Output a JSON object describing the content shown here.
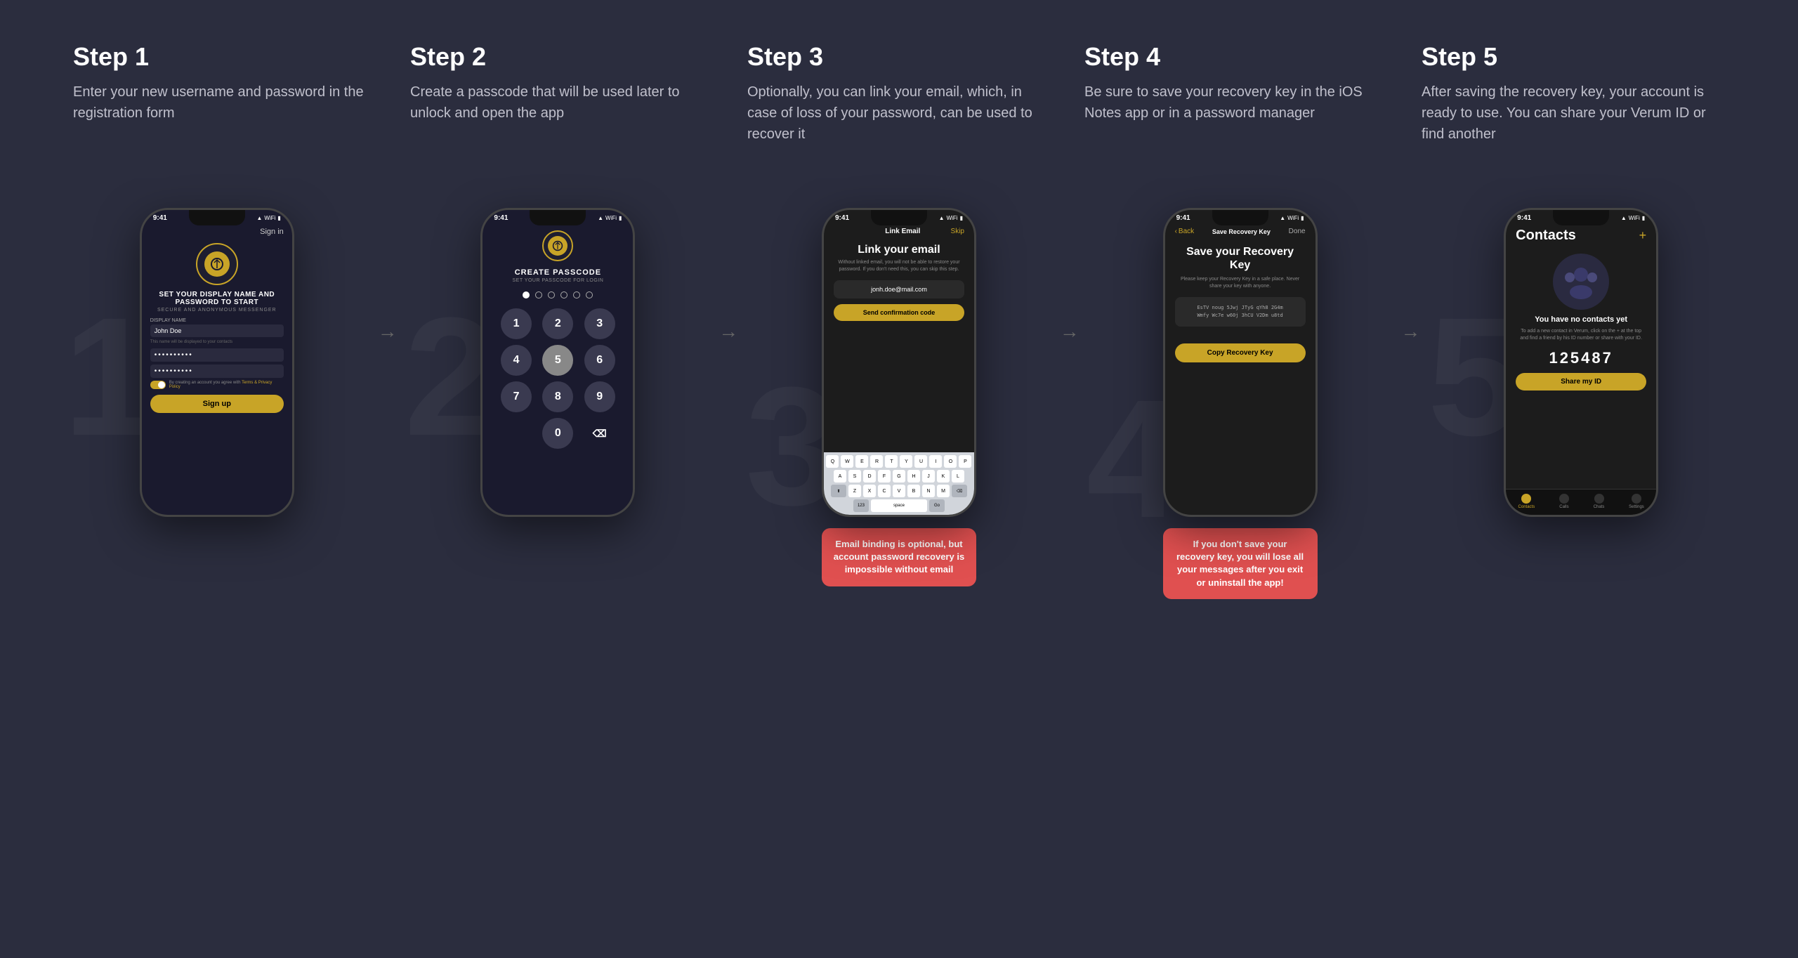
{
  "steps": [
    {
      "number": "Step 1",
      "description": "Enter your new username and password in the registration form",
      "bg_number": "1"
    },
    {
      "number": "Step 2",
      "description": "Create a passcode that will be used later to unlock and open the app",
      "bg_number": "2"
    },
    {
      "number": "Step 3",
      "description": "Optionally, you can link your email, which, in case of loss of your password, can be used to recover it",
      "bg_number": "3"
    },
    {
      "number": "Step 4",
      "description": "Be sure to save your recovery key in the iOS Notes app or in a password manager",
      "bg_number": "4"
    },
    {
      "number": "Step 5",
      "description": "After saving the recovery key, your account is ready to use. You can share your Verum ID or find another",
      "bg_number": "5"
    }
  ],
  "phone1": {
    "time": "9:41",
    "sign_in": "Sign in",
    "title": "SET YOUR DISPLAY NAME AND PASSWORD TO START",
    "subtitle": "SECURE AND ANONYMOUS MESSENGER",
    "display_name_label": "DISPLAY NAME",
    "display_name_value": "John Doe",
    "display_name_hint": "This name will be displayed to your contacts",
    "terms_text": "By creating an account you agree with Terms & Privacy Policy",
    "btn_label": "Sign up"
  },
  "phone2": {
    "time": "9:41",
    "title": "CREATE PASSCODE",
    "subtitle": "SET YOUR PASSCODE FOR LOGIN",
    "numbers": [
      "1",
      "2",
      "3",
      "4",
      "5",
      "6",
      "7",
      "8",
      "9",
      "0"
    ]
  },
  "phone3": {
    "time": "9:41",
    "header_title": "Link Email",
    "skip": "Skip",
    "title": "Link your email",
    "desc": "Without linked email, you will not be able to restore your password. If you don't need this, you can skip this step.",
    "email_placeholder": "jonh.doe@mail.com",
    "btn_label": "Send confirmation code",
    "warning": "Email binding is optional, but account password recovery is impossible without email"
  },
  "phone4": {
    "time": "9:41",
    "back": "Back",
    "header_title": "Save Recovery Key",
    "done": "Done",
    "title": "Save your Recovery Key",
    "desc": "Please keep your Recovery Key in a safe place. Never share your key with anyone.",
    "recovery_key_line1": "EsTV noug 5Jwj JTyG qYh8 2G4m",
    "recovery_key_line2": "Wmfy Wc7e w60j 3hCU V2Dm u8td",
    "btn_label": "Copy Recovery Key",
    "warning": "If you don't save your recovery key, you will lose all your messages after you exit or uninstall the app!"
  },
  "phone5": {
    "time": "9:41",
    "title": "Contacts",
    "plus": "+",
    "no_contacts": "You have no contacts yet",
    "no_contacts_desc": "To add a new contact in Verum, click on the + at the top and find a friend by his ID number or share with your ID.",
    "user_id": "125487",
    "btn_label": "Share my ID",
    "nav_items": [
      "Contacts",
      "Calls",
      "Chats",
      "Settings"
    ]
  }
}
